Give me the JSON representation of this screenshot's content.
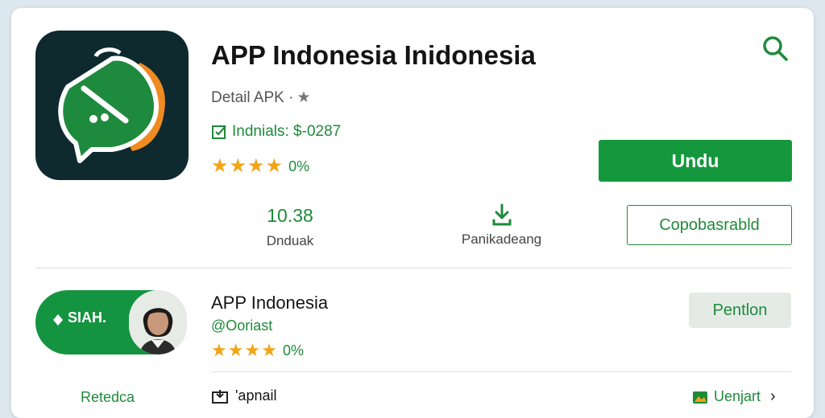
{
  "header": {
    "title": "APP Indonesia  Inidonesia",
    "detail": "Detail APK ·",
    "installs": "Indnials: $-0287",
    "rating_text": "0%",
    "rating_stars": 3.5
  },
  "actions": {
    "primary_label": "Undu",
    "secondary_label": "Copobasrabld"
  },
  "stats": [
    {
      "value": "10.38",
      "label": "Dnduak"
    },
    {
      "label": "Panikadeang"
    }
  ],
  "related": {
    "banner_text": "SIAH.",
    "title": "APP Indonesia",
    "subtitle": "@Ooriast",
    "rating_text": "0%",
    "rating_stars": 3.5,
    "action_label": "Pentlon"
  },
  "footer": {
    "left_label": "Retedca",
    "middle_label": "'apnail",
    "right_label": "Uenjart"
  },
  "colors": {
    "accent": "#15973d",
    "text_green": "#1f8a3a",
    "star": "#f2a417",
    "icon_bg": "#0f2a2e",
    "icon_orange": "#f08a22"
  },
  "icons": [
    "app-logo-icon",
    "search-icon",
    "star-icon",
    "install-check-icon",
    "download-icon",
    "image-icon",
    "gallery-icon",
    "chevron-right-icon"
  ]
}
